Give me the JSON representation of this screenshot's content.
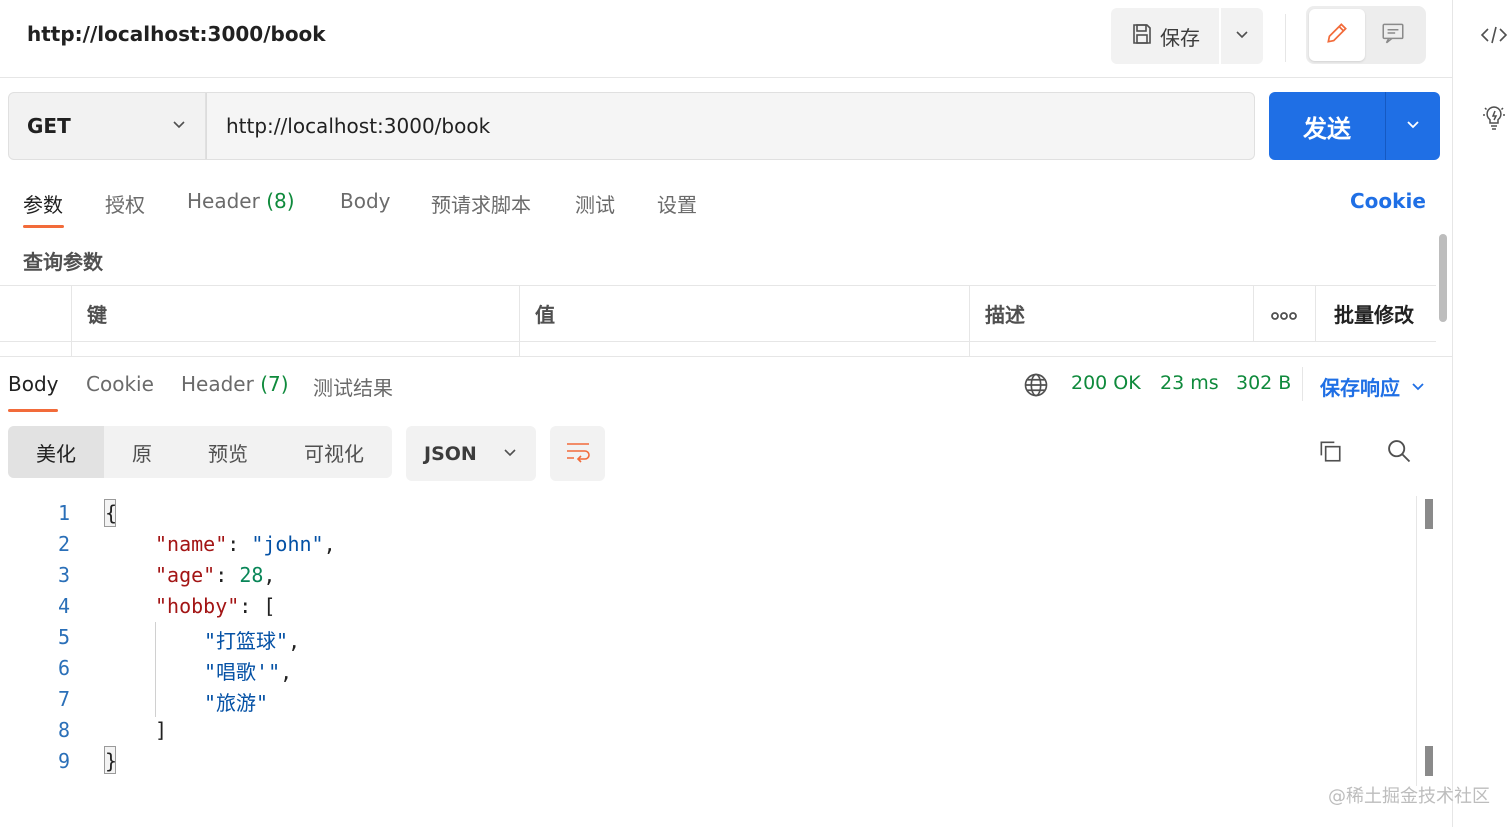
{
  "topbar": {
    "tab_url": "http://localhost:3000/book",
    "save_label": "保存"
  },
  "request": {
    "method": "GET",
    "url": "http://localhost:3000/book",
    "send_label": "发送"
  },
  "request_tabs": [
    {
      "label": "参数",
      "count": ""
    },
    {
      "label": "授权",
      "count": ""
    },
    {
      "label": "Header",
      "count": "(8)"
    },
    {
      "label": "Body",
      "count": ""
    },
    {
      "label": "预请求脚本",
      "count": ""
    },
    {
      "label": "测试",
      "count": ""
    },
    {
      "label": "设置",
      "count": ""
    }
  ],
  "cookie_link": "Cookie",
  "params": {
    "title": "查询参数",
    "columns": [
      "键",
      "值",
      "描述"
    ],
    "more_label": "ooo",
    "bulk_edit": "批量修改"
  },
  "response_tabs": [
    {
      "label": "Body",
      "count": ""
    },
    {
      "label": "Cookie",
      "count": ""
    },
    {
      "label": "Header",
      "count": "(7)"
    },
    {
      "label": "测试结果",
      "count": ""
    }
  ],
  "status": {
    "code": "200 OK",
    "time": "23 ms",
    "size": "302 B",
    "save_response": "保存响应"
  },
  "view_options": [
    "美化",
    "原",
    "预览",
    "可视化"
  ],
  "format": "JSON",
  "code_lines": [
    "1",
    "2",
    "3",
    "4",
    "5",
    "6",
    "7",
    "8",
    "9"
  ],
  "json_body": {
    "open_brace": "{",
    "name_key": "\"name\"",
    "name_value": "\"john\"",
    "age_key": "\"age\"",
    "age_value": "28",
    "hobby_key": "\"hobby\"",
    "hobby_items": [
      "\"打篮球\"",
      "\"唱歌'\"",
      "\"旅游\""
    ],
    "close_bracket": "]",
    "close_brace": "}"
  },
  "watermark": "@稀土掘金技术社区",
  "colors": {
    "accent": "#1f6fe5",
    "active_tab": "#f26b3a",
    "success": "#0f8a3c"
  }
}
